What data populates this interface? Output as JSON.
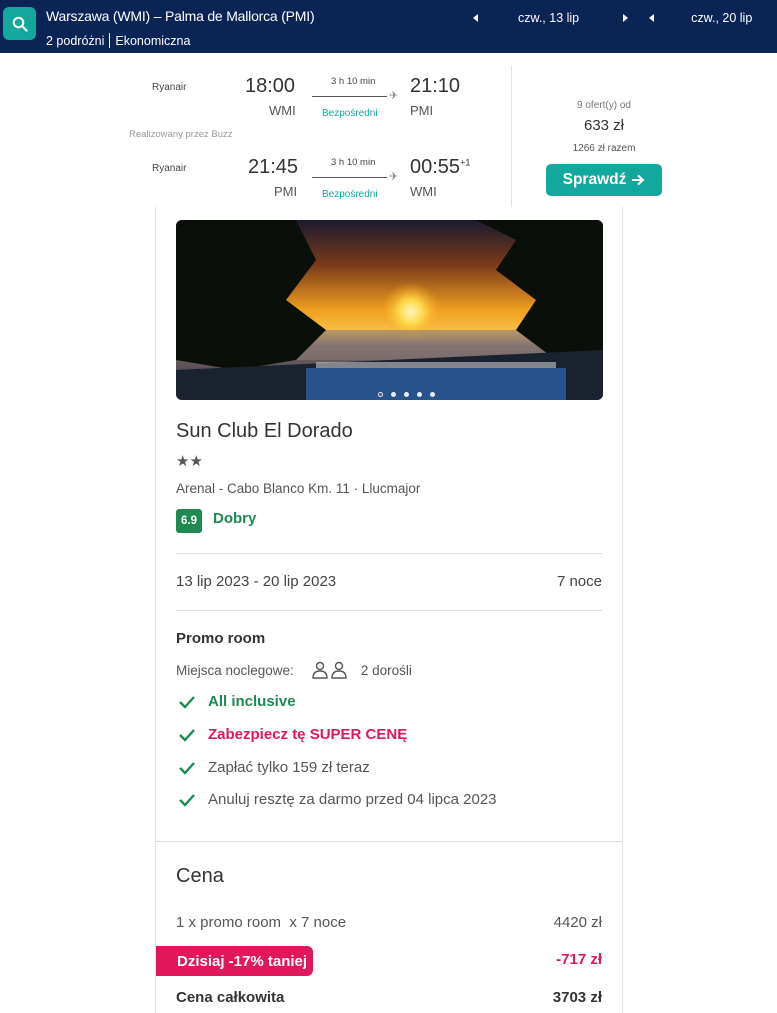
{
  "header": {
    "route": "Warszawa (WMI) – Palma de Mallorca (PMI)",
    "travelers": "2 podróżni",
    "cabin": "Ekonomiczna",
    "depart_date": "czw., 13 lip",
    "return_date": "czw., 20 lip",
    "icon": "search-icon"
  },
  "flight": {
    "outbound": {
      "airline": "Ryanair",
      "dep_time": "18:00",
      "dep_code": "WMI",
      "duration": "3 h 10 min",
      "stops": "Bezpośredni",
      "arr_time": "21:10",
      "arr_code": "PMI"
    },
    "operated_by": "Realizowany przez Buzz",
    "inbound": {
      "airline": "Ryanair",
      "dep_time": "21:45",
      "dep_code": "PMI",
      "duration": "3 h 10 min",
      "stops": "Bezpośredni",
      "arr_time": "00:55",
      "arr_day_offset": "+1",
      "arr_code": "WMI"
    },
    "offers_count": "9 ofert(y) od",
    "price": "633 zł",
    "total": "1266 zł razem",
    "cta": "Sprawdź"
  },
  "hotel": {
    "name": "Sun Club El Dorado",
    "stars": "★★",
    "address": "Arenal - Cabo Blanco Km. 11 · Llucmajor",
    "rating_score": "6.9",
    "rating_label": "Dobry",
    "dates": "13 lip 2023 - 20 lip 2023",
    "nights": "7 noce",
    "room": "Promo room",
    "sleeps_label": "Miejsca noclegowe:",
    "sleeps_value": "2 dorośli",
    "features": [
      {
        "text": "All inclusive",
        "style": "green"
      },
      {
        "text": "Zabezpiecz tę SUPER CENĘ",
        "style": "pink"
      },
      {
        "text": "Zapłać tylko 159 zł teraz",
        "style": "grey"
      },
      {
        "text": "Anuluj resztę za darmo przed 04 lipca 2023",
        "style": "grey"
      }
    ],
    "price_section": {
      "title": "Cena",
      "line_label": "1 x promo room  x 7 noce",
      "line_value": "4420 zł",
      "discount_label": "Dzisiaj -17% taniej",
      "discount_value": "-717 zł",
      "total_label": "Cena całkowita",
      "total_value": "3703 zł"
    }
  },
  "colors": {
    "header_bg": "#0a2456",
    "teal": "#13a89e",
    "green": "#1e8a52",
    "pink": "#e0185b"
  }
}
